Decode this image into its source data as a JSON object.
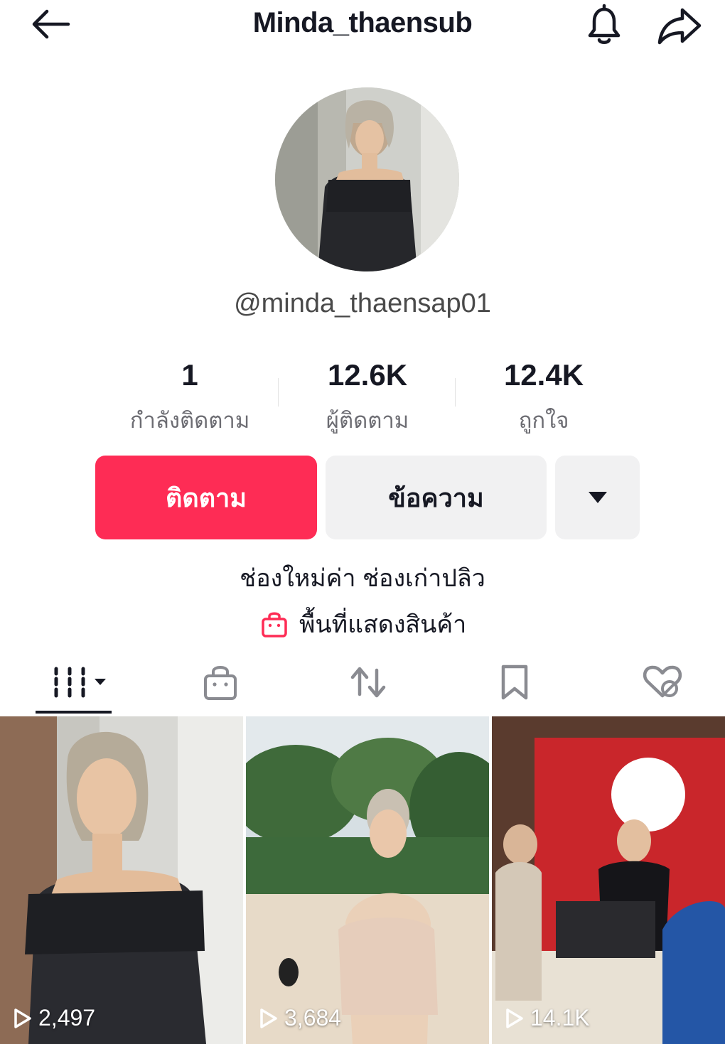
{
  "header": {
    "title": "Minda_thaensub",
    "back_icon": "arrow-left-icon",
    "bell_icon": "bell-icon",
    "share_icon": "share-arrow-icon"
  },
  "profile": {
    "handle": "@minda_thaensap01",
    "stats": [
      {
        "value": "1",
        "label": "กำลังติดตาม"
      },
      {
        "value": "12.6K",
        "label": "ผู้ติดตาม"
      },
      {
        "value": "12.4K",
        "label": "ถูกใจ"
      }
    ],
    "follow_label": "ติดตาม",
    "message_label": "ข้อความ",
    "bio": "ช่องใหม่ค่า ช่องเก่าปลิว",
    "showcase_label": "พื้นที่แสดงสินค้า"
  },
  "tabs": [
    {
      "icon": "videos-grid-icon",
      "active": true
    },
    {
      "icon": "shopping-bag-icon",
      "active": false
    },
    {
      "icon": "repost-icon",
      "active": false
    },
    {
      "icon": "bookmark-icon",
      "active": false
    },
    {
      "icon": "liked-hidden-icon",
      "active": false
    }
  ],
  "videos": [
    {
      "views": "2,497"
    },
    {
      "views": "3,684"
    },
    {
      "views": "14.1K"
    }
  ],
  "colors": {
    "accent": "#fe2c55",
    "button_gray": "#f1f1f2",
    "text": "#161823",
    "secondary_text": "#6c6c72"
  }
}
